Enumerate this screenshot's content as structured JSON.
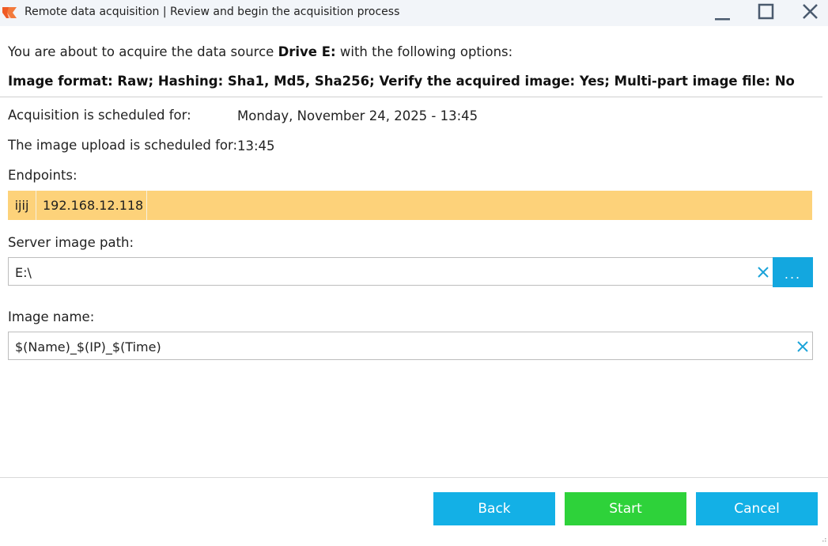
{
  "window": {
    "title": "Remote data acquisition | Review and begin the acquisition process"
  },
  "summary": {
    "intro_prefix": "You are about to acquire the data source ",
    "source": "Drive E:",
    "intro_suffix": " with the following options:",
    "options": "Image format: Raw; Hashing: Sha1, Md5, Sha256; Verify the acquired image: Yes; Multi-part image file: No"
  },
  "schedule": {
    "acquisition_label": "Acquisition is scheduled for:",
    "acquisition_value": "Monday, November 24, 2025 - 13:45",
    "upload_label": "The image upload is scheduled for:",
    "upload_value": "13:45"
  },
  "endpoints": {
    "label": "Endpoints:",
    "items": [
      {
        "name": "ijij",
        "ip": "192.168.12.118"
      }
    ]
  },
  "server_path": {
    "label": "Server image path:",
    "value": "E:\\",
    "browse_label": "..."
  },
  "image_name": {
    "label": "Image name:",
    "value": "$(Name)_$(IP)_$(Time)"
  },
  "footer": {
    "back_label": "Back",
    "start_label": "Start",
    "cancel_label": "Cancel"
  },
  "colors": {
    "titlebar_bg": "#f2f5f9",
    "endpoint_highlight": "#fdd27a",
    "accent_blue": "#13b0e6",
    "start_green": "#2ed23a",
    "clear_icon": "#1aa3d9",
    "logo_orange": "#ef5a24"
  },
  "icons": {
    "app": "app-logo-icon",
    "minimize": "minimize-icon",
    "maximize": "maximize-icon",
    "close": "close-icon",
    "clear": "clear-x-icon",
    "resize": "resize-grip-icon"
  }
}
